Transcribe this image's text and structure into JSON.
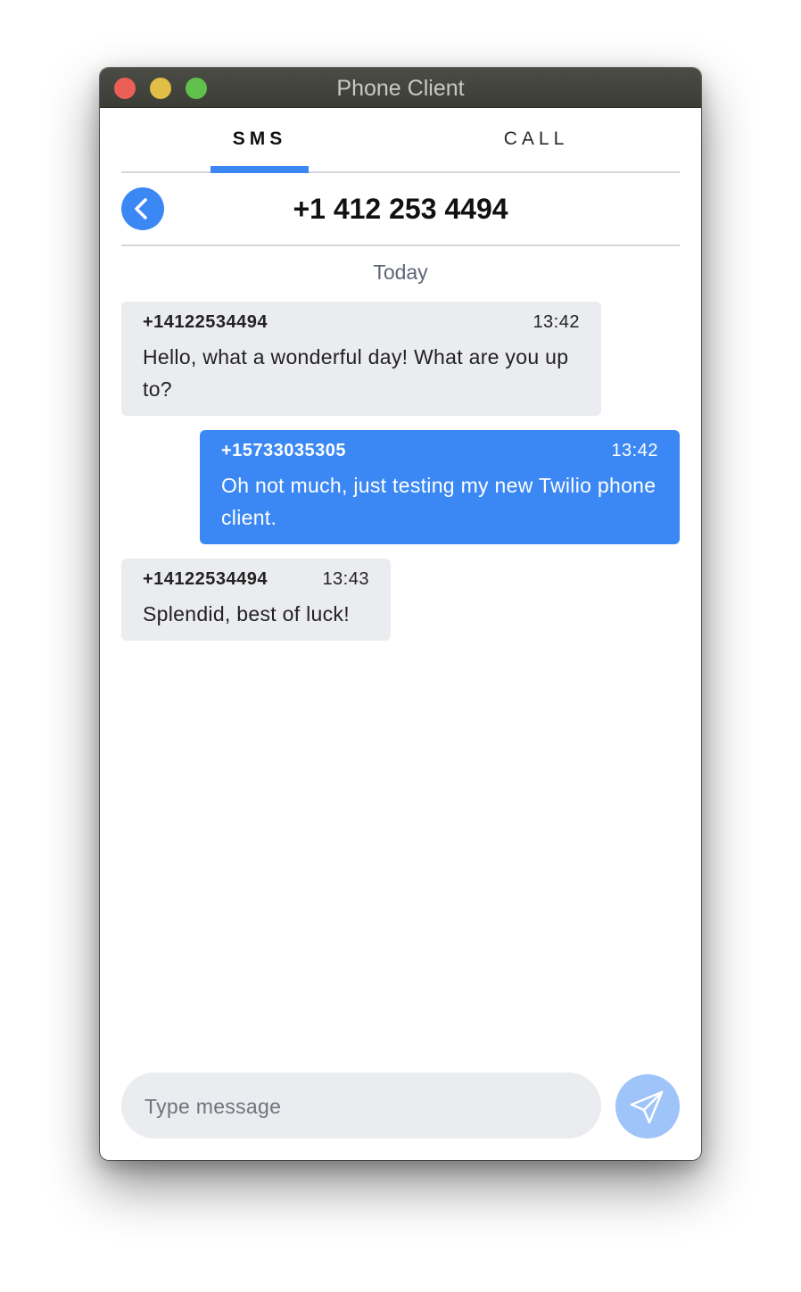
{
  "window": {
    "title": "Phone Client"
  },
  "tabs": [
    {
      "label": "SMS",
      "active": true
    },
    {
      "label": "CALL",
      "active": false
    }
  ],
  "conversation": {
    "contact": "+1 412 253 4494",
    "day_label": "Today",
    "messages": [
      {
        "direction": "incoming",
        "sender": "+14122534494",
        "time": "13:42",
        "text": "Hello, what a wonderful day! What are you up to?"
      },
      {
        "direction": "outgoing",
        "sender": "+15733035305",
        "time": "13:42",
        "text": "Oh not much, just testing my new Twilio phone client."
      },
      {
        "direction": "incoming",
        "sender": "+14122534494",
        "time": "13:43",
        "text": "Splendid, best of luck!"
      }
    ]
  },
  "composer": {
    "placeholder": "Type message",
    "value": ""
  },
  "icons": {
    "back": "chevron-left-icon",
    "send": "paper-plane-icon"
  },
  "colors": {
    "accent": "#3b88f5",
    "incoming_bubble": "#ebecef",
    "send_button": "#9ec4fa",
    "titlebar": "#45463f"
  }
}
